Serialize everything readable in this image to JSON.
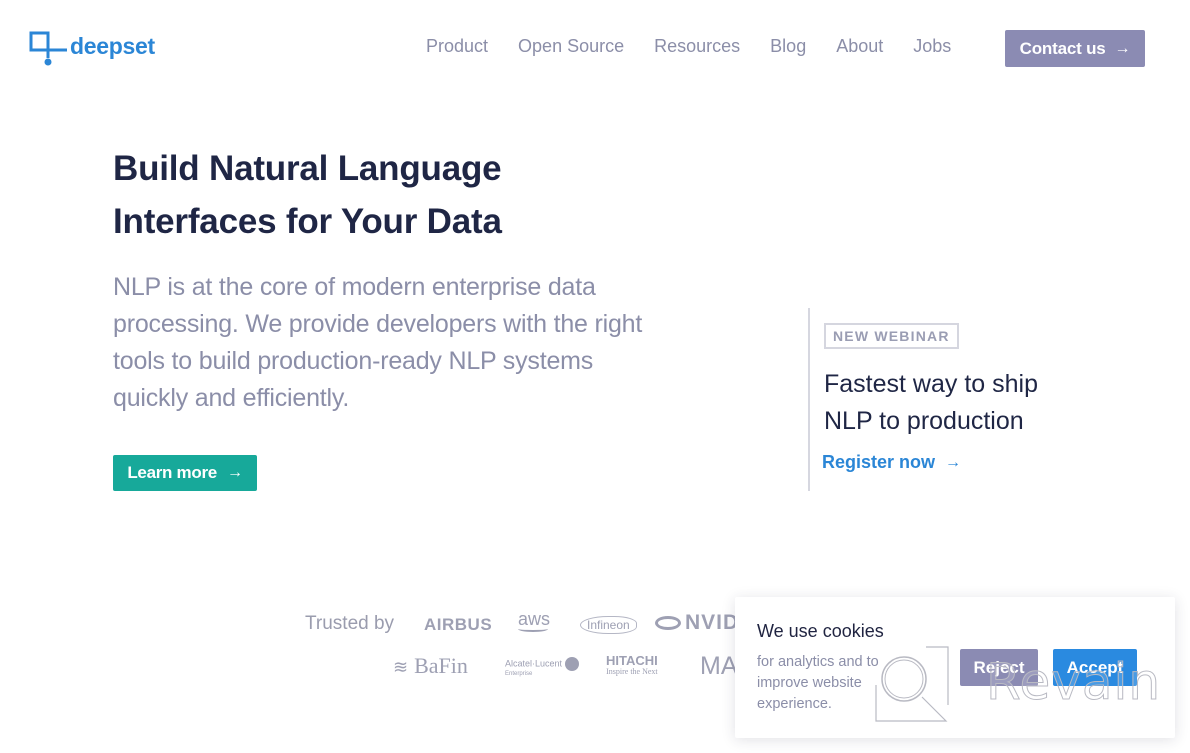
{
  "brand": {
    "name": "deepset",
    "color": "#2b86d6"
  },
  "nav": {
    "items": [
      {
        "label": "Product"
      },
      {
        "label": "Open Source"
      },
      {
        "label": "Resources"
      },
      {
        "label": "Blog"
      },
      {
        "label": "About"
      },
      {
        "label": "Jobs"
      }
    ],
    "contact_label": "Contact us",
    "arrow": "→"
  },
  "hero": {
    "title": "Build Natural Language Interfaces for Your Data",
    "description": "NLP is at the core of modern enterprise data processing. We provide developers with the right tools to build production-ready NLP systems quickly and efficiently.",
    "cta_label": "Learn more",
    "cta_color": "#17a99a"
  },
  "webinar": {
    "badge": "NEW WEBINAR",
    "title": "Fastest way to ship NLP to production",
    "link_label": "Register now"
  },
  "trusted": {
    "label": "Trusted by",
    "logos": {
      "airbus": "AIRBUS",
      "aws": "aws",
      "infineon": "Infineon",
      "nvidia": "NVIDI",
      "bafin": "BaFin",
      "bafin_waves": "≋",
      "alcatel": "Alcatel·Lucent",
      "alcatel_sub": "Enterprise",
      "hitachi": "HITACHI",
      "hitachi_sub": "Inspire the Next",
      "ma": "MA"
    }
  },
  "cookie": {
    "title": "We use cookies",
    "text": "for analytics and to improve website experience.",
    "reject_label": "Reject",
    "accept_label": "Accept",
    "accept_color": "#2a8ae0",
    "reject_color": "#8b8bb3"
  },
  "watermark": {
    "text": "Revain"
  }
}
